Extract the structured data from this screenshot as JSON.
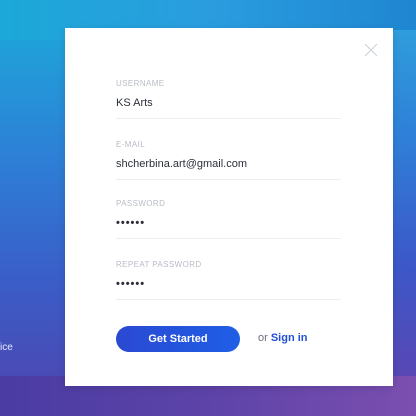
{
  "form": {
    "username": {
      "label": "USERNAME",
      "value": "KS Arts"
    },
    "email": {
      "label": "E-MAIL",
      "value": "shcherbina.art@gmail.com"
    },
    "password": {
      "label": "PASSWORD",
      "value": "••••••"
    },
    "repeat_password": {
      "label": "REPEAT PASSWORD",
      "value": "••••••"
    },
    "submit_label": "Get Started",
    "alt_prefix": "or",
    "alt_link": "Sign in"
  },
  "background": {
    "partial_text": "ice"
  },
  "colors": {
    "accent": "#1f5ee6",
    "link": "#1f4fd8",
    "label": "#b8bcc6"
  }
}
